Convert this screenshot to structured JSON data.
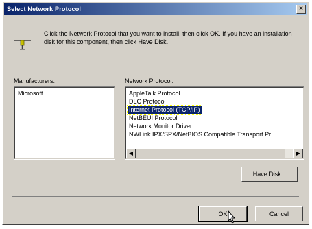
{
  "window": {
    "title": "Select Network Protocol",
    "close_glyph": "×"
  },
  "instruction": "Click the Network Protocol that you want to install, then click OK. If you have an installation disk for this component, then click Have Disk.",
  "manufacturers": {
    "label": "Manufacturers:",
    "items": [
      "Microsoft"
    ],
    "selected_index": 0
  },
  "protocols": {
    "label": "Network Protocol:",
    "items": [
      "AppleTalk Protocol",
      "DLC Protocol",
      "Internet Protocol (TCP/IP)",
      "NetBEUI Protocol",
      "Network Monitor Driver",
      "NWLink IPX/SPX/NetBIOS Compatible Transport Pr"
    ],
    "selected_index": 2,
    "scroll_left": "◀",
    "scroll_right": "▶"
  },
  "buttons": {
    "have_disk": "Have Disk...",
    "ok": "OK",
    "cancel": "Cancel"
  },
  "icons": {
    "dialog": "network-plug-icon",
    "cursor": "mouse-pointer-icon"
  },
  "colors": {
    "title_start": "#0a246a",
    "title_end": "#a6caf0",
    "selection": "#0a246a",
    "face": "#d4d0c8"
  }
}
